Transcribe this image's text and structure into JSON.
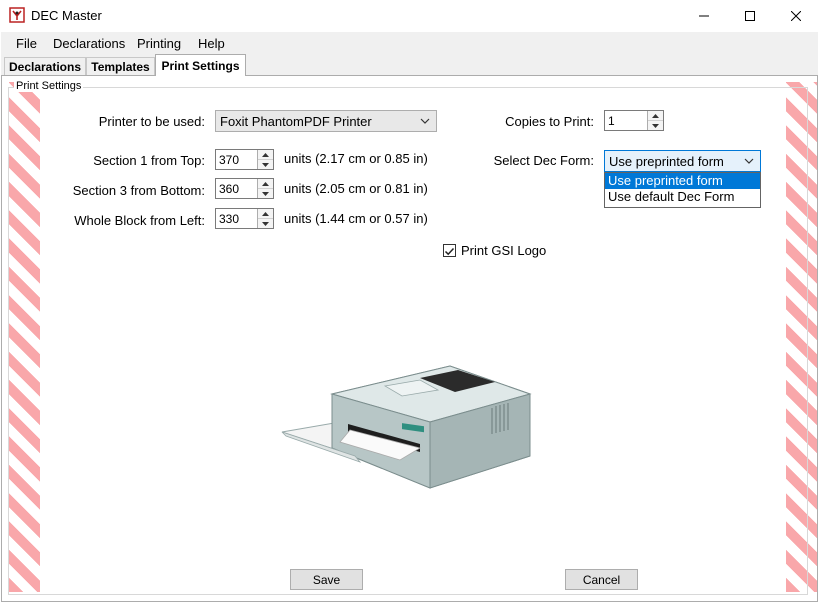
{
  "window": {
    "title": "DEC Master",
    "icons": {
      "app": "dec-master-app-icon",
      "minimize": "minimize-icon",
      "maximize": "maximize-icon",
      "close": "close-icon"
    }
  },
  "menu": {
    "items": [
      {
        "label": "File"
      },
      {
        "label": "Declarations"
      },
      {
        "label": "Printing"
      },
      {
        "label": "Help"
      }
    ]
  },
  "tabs": [
    {
      "label": "Declarations"
    },
    {
      "label": "Templates"
    },
    {
      "label": "Print Settings",
      "active": true
    }
  ],
  "print_settings": {
    "group_label": "Print Settings",
    "printer_label": "Printer to be used:",
    "printer_value": "Foxit PhantomPDF Printer",
    "section1_label": "Section 1 from Top:",
    "section1_value": "370",
    "section1_units": "units (2.17 cm or 0.85 in)",
    "section3_label": "Section 3 from Bottom:",
    "section3_value": "360",
    "section3_units": "units (2.05 cm or 0.81 in)",
    "whole_block_label": "Whole Block from Left:",
    "whole_block_value": "330",
    "whole_block_units": "units (1.44 cm or 0.57 in)",
    "copies_label": "Copies to Print:",
    "copies_value": "1",
    "dec_form_label": "Select Dec Form:",
    "dec_form_value": "Use preprinted form",
    "dec_form_options": [
      {
        "label": "Use preprinted form",
        "selected": true
      },
      {
        "label": "Use default Dec Form",
        "selected": false
      }
    ],
    "print_logo_label": "Print GSI Logo",
    "print_logo_checked": true,
    "image": "printer-illustration",
    "save_label": "Save",
    "cancel_label": "Cancel"
  },
  "colors": {
    "stripe": "#f9a7aa",
    "selection": "#0078d7",
    "tab_strip": "#f0f0f0"
  }
}
